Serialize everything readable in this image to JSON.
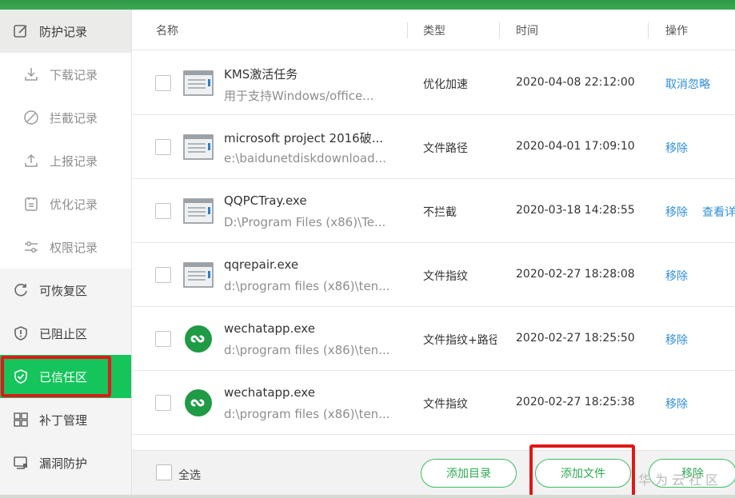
{
  "sidebar": {
    "items": [
      {
        "label": "防护记录",
        "icon": "edit-icon"
      },
      {
        "label": "下载记录",
        "icon": "download-icon"
      },
      {
        "label": "拦截记录",
        "icon": "block-icon"
      },
      {
        "label": "上报记录",
        "icon": "upload-icon"
      },
      {
        "label": "优化记录",
        "icon": "clipboard-icon"
      },
      {
        "label": "权限记录",
        "icon": "sliders-icon"
      },
      {
        "label": "可恢复区",
        "icon": "refresh-icon"
      },
      {
        "label": "已阻止区",
        "icon": "shield-alert-icon"
      },
      {
        "label": "已信任区",
        "icon": "shield-check-icon"
      },
      {
        "label": "补丁管理",
        "icon": "grid-icon"
      },
      {
        "label": "漏洞防护",
        "icon": "monitor-icon"
      }
    ],
    "active": "已信任区"
  },
  "table": {
    "columns": [
      "名称",
      "类型",
      "时间",
      "操作"
    ],
    "rows": [
      {
        "name": "KMS激活任务",
        "desc": "用于支持Windows/office...",
        "type": "优化加速",
        "time": "2020-04-08 22:12:00",
        "actions": [
          "取消忽略"
        ],
        "icon": "window-icon"
      },
      {
        "name": "microsoft project 2016破...",
        "desc": "e:\\baidunetdiskdownload...",
        "type": "文件路径",
        "time": "2020-04-01 17:09:10",
        "actions": [
          "移除"
        ],
        "icon": "window-icon"
      },
      {
        "name": "QQPCTray.exe",
        "desc": "D:\\Program Files (x86)\\Te...",
        "type": "不拦截",
        "time": "2020-03-18 14:28:55",
        "actions": [
          "移除",
          "查看详"
        ],
        "icon": "window-icon"
      },
      {
        "name": "qqrepair.exe",
        "desc": "d:\\program files (x86)\\ten...",
        "type": "文件指纹",
        "time": "2020-02-27 18:28:08",
        "actions": [
          "移除"
        ],
        "icon": "window-icon"
      },
      {
        "name": "wechatapp.exe",
        "desc": "d:\\program files (x86)\\ten...",
        "type": "文件指纹+路径",
        "time": "2020-02-27 18:25:50",
        "actions": [
          "移除"
        ],
        "icon": "miniprogram-icon"
      },
      {
        "name": "wechatapp.exe",
        "desc": "d:\\program files (x86)\\ten...",
        "type": "文件指纹",
        "time": "2020-02-27 18:25:38",
        "actions": [
          "移除"
        ],
        "icon": "miniprogram-icon"
      }
    ]
  },
  "footer": {
    "select_all": "全选",
    "add_dir": "添加目录",
    "add_file": "添加文件",
    "remove": "移除",
    "watermark": "华为云社区"
  },
  "colors": {
    "accent": "#15c45a",
    "link": "#2f8fd6",
    "highlight": "#e01818"
  }
}
